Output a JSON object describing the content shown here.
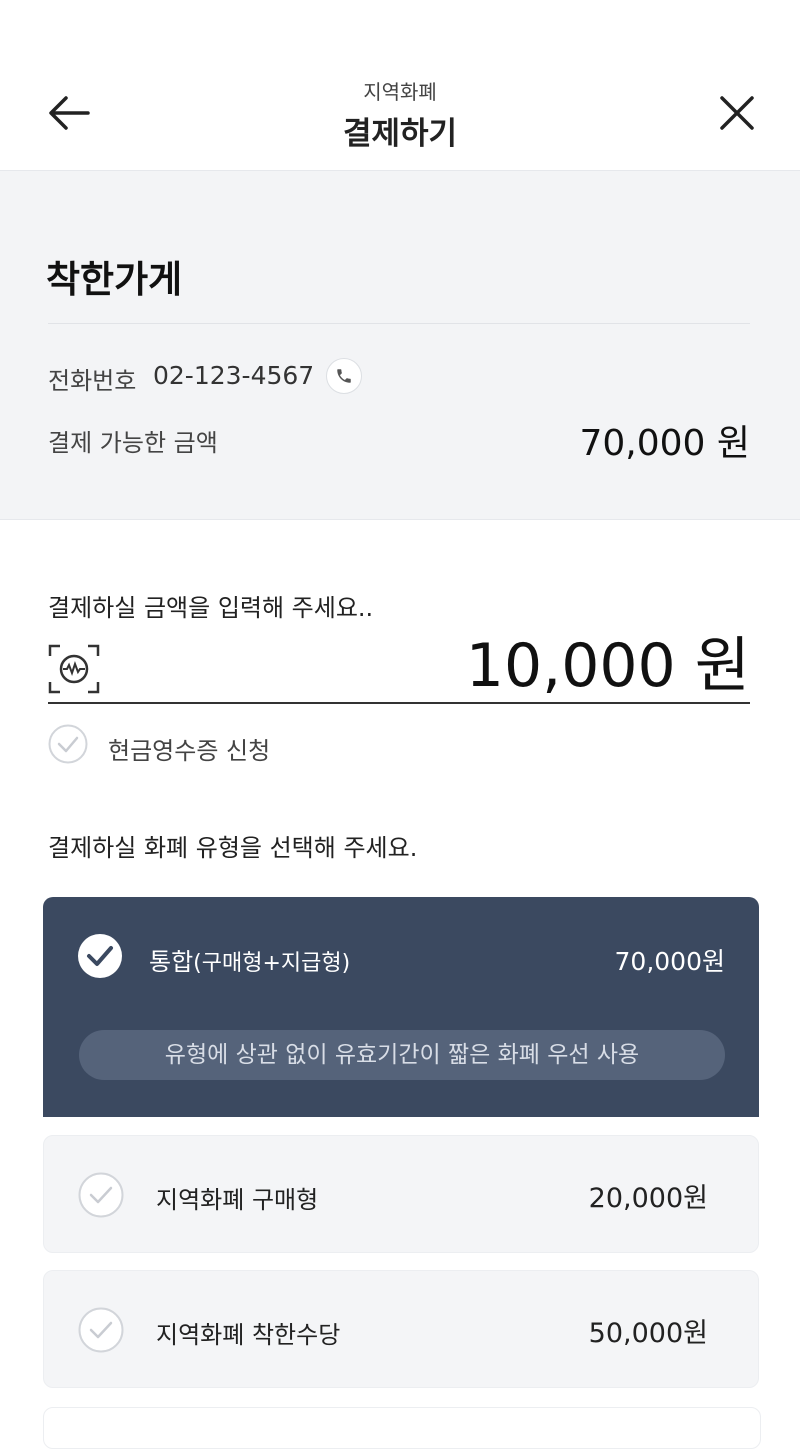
{
  "header": {
    "subtitle": "지역화폐",
    "title": "결제하기",
    "back_icon": "arrow-left-icon",
    "close_icon": "close-icon"
  },
  "store": {
    "name": "착한가게",
    "phone_label": "전화번호",
    "phone_number": "02-123-4567",
    "phone_icon": "phone-icon",
    "available_label": "결제 가능한 금액",
    "available_amount": "70,000 원"
  },
  "payment": {
    "amount_prompt": "결제하실 금액을 입력해 주세요..",
    "amount_value": "10,000 원",
    "scan_icon": "scan-icon",
    "cash_receipt_label": "현금영수증 신청",
    "cash_receipt_checked": false
  },
  "currency_types": {
    "prompt": "결제하실 화폐 유형을 선택해 주세요.",
    "options": [
      {
        "label": "통합",
        "label_paren": "(구매형+지급형)",
        "amount": "70,000원",
        "selected": true,
        "note": "유형에 상관 없이 유효기간이 짧은 화폐 우선 사용"
      },
      {
        "label": "지역화폐 구매형",
        "amount": "20,000원",
        "selected": false
      },
      {
        "label": "지역화폐 착한수당",
        "amount": "50,000원",
        "selected": false
      }
    ]
  },
  "colors": {
    "selected_card": "#3b4960",
    "panel_bg": "#f3f4f6"
  }
}
